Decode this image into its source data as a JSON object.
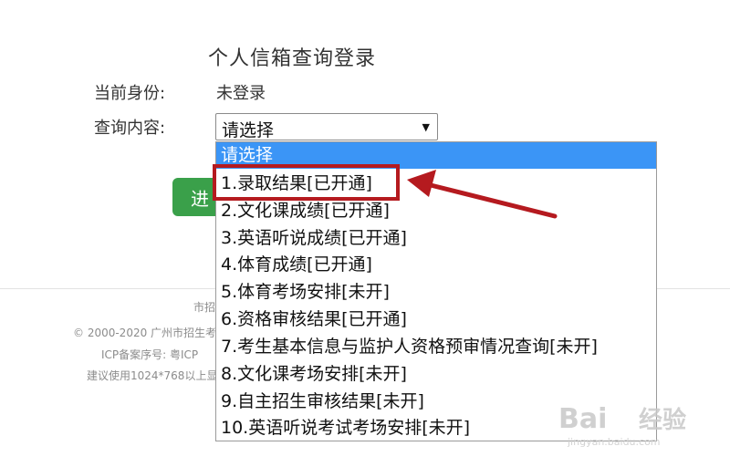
{
  "page": {
    "title": "个人信箱查询登录"
  },
  "form": {
    "identity_label": "当前身份:",
    "identity_value": "未登录",
    "query_label": "查询内容:",
    "select_value": "请选择",
    "enter_button": "进"
  },
  "dropdown": {
    "options": [
      "请选择",
      "1.录取结果[已开通]",
      "2.文化课成绩[已开通]",
      "3.英语听说成绩[已开通]",
      "4.体育成绩[已开通]",
      "5.体育考场安排[未开]",
      "6.资格审核结果[已开通]",
      "7.考生基本信息与监护人资格预审情况查询[未开]",
      "8.文化课考场安排[未开]",
      "9.自主招生审核结果[未开]",
      "10.英语听说考试考场安排[未开]"
    ],
    "selected_index": 0
  },
  "footer": {
    "line1": "市招",
    "line2": "© 2000-2020 广州市招生考",
    "line3": "ICP备案序号: 粤ICP",
    "line4": "建议使用1024*768以上显"
  },
  "watermark": {
    "brand": "Bai",
    "brand2": "经验",
    "url": "jingyan.baidu.com"
  },
  "colors": {
    "selected_bg": "#3b95f6",
    "button_green": "#3aa04a",
    "annotation_red": "#b51a1f"
  }
}
